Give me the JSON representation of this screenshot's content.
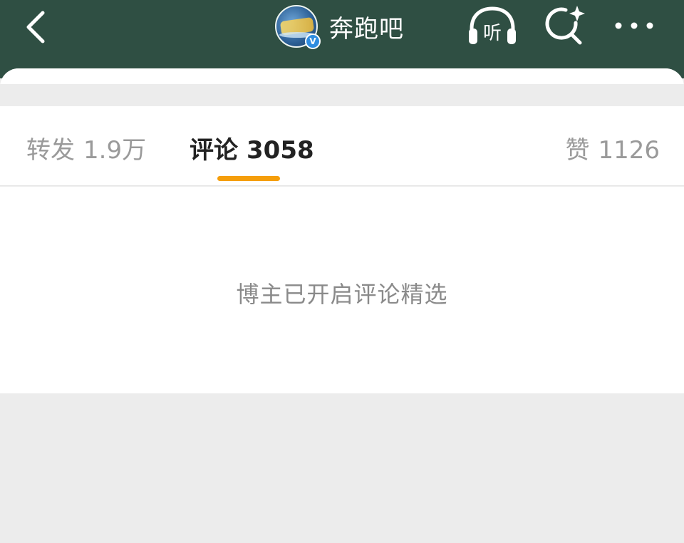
{
  "header": {
    "title": "奔跑吧",
    "avatar_verified_mark": "V",
    "listen_label": "听",
    "icons": {
      "back": "back-chevron-icon",
      "listen": "headphones-icon",
      "search": "search-sparkle-icon",
      "more": "more-dots-icon"
    },
    "colors": {
      "bar": "#2f4f43",
      "foreground": "#ffffff"
    }
  },
  "tabs": [
    {
      "label": "转发",
      "count": "1.9万",
      "active": false
    },
    {
      "label": "评论",
      "count": "3058",
      "active": true
    },
    {
      "label": "赞",
      "count": "1126",
      "active": false
    }
  ],
  "colors": {
    "active_indicator": "#f59e0b",
    "inactive_tab_text": "#9a9a9a",
    "active_tab_text": "#222222",
    "page_background": "#ececec"
  },
  "content": {
    "notice": "博主已开启评论精选"
  }
}
